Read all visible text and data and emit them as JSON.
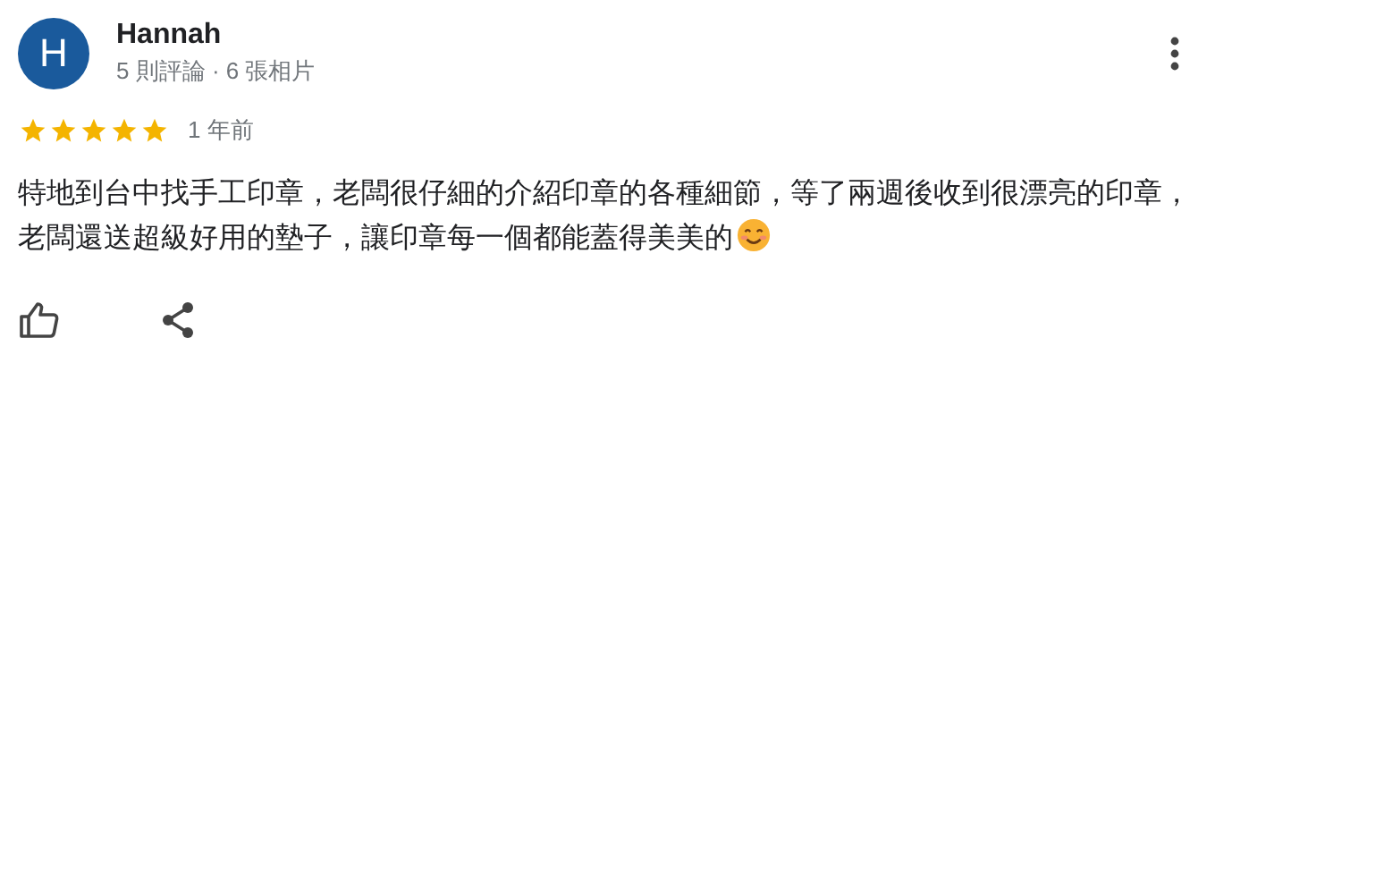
{
  "review": {
    "avatar_letter": "H",
    "author": "Hannah",
    "meta": "5 則評論 · 6 張相片",
    "stars": 5,
    "time": "1 年前",
    "text": "特地到台中找手工印章，老闆很仔細的介紹印章的各種細節，等了兩週後收到很漂亮的印章，老闆還送超級好用的墊子，讓印章每一個都能蓋得美美的"
  }
}
